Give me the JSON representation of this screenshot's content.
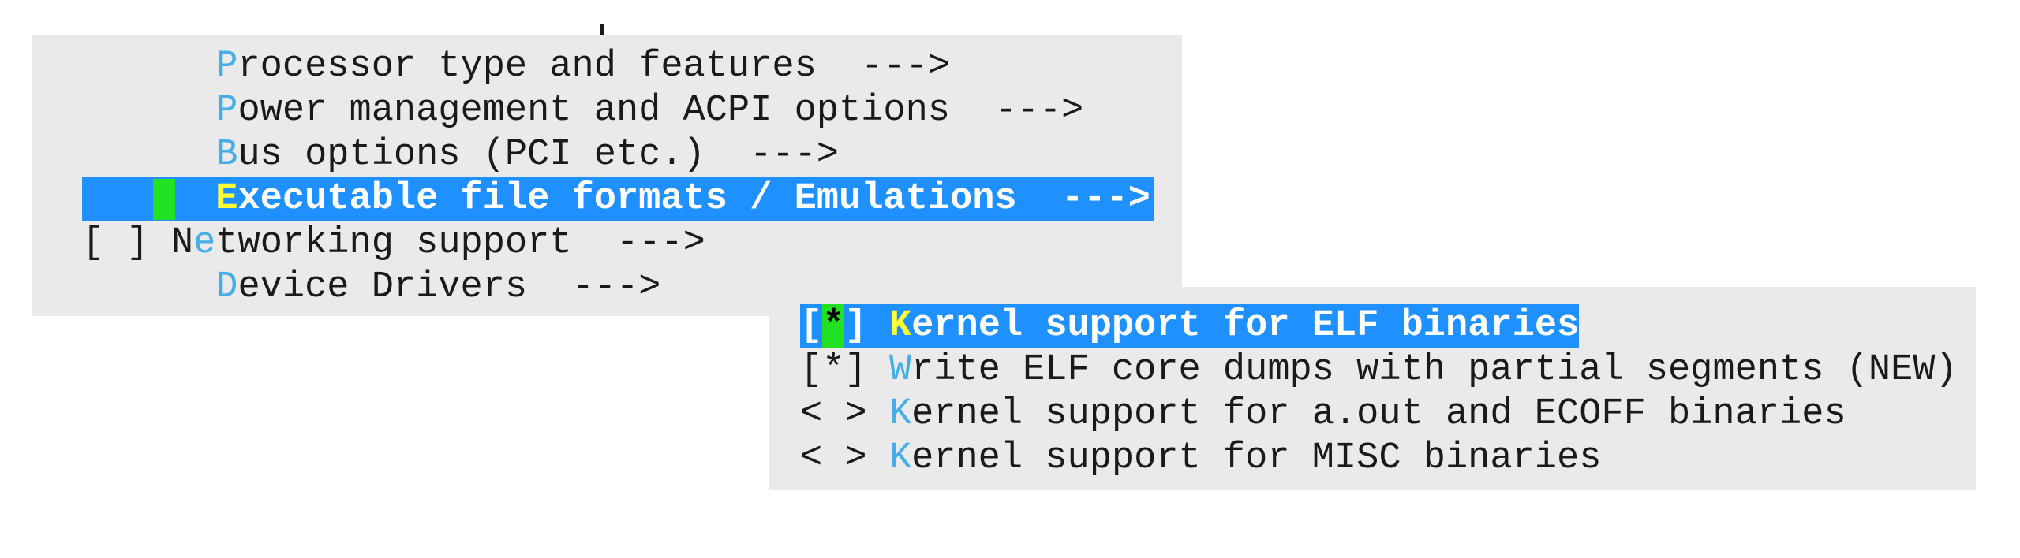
{
  "top_menu": {
    "items": [
      {
        "indicator": "   ",
        "hotkey": "P",
        "rest": "rocessor type and features",
        "arrow": "--->"
      },
      {
        "indicator": "   ",
        "hotkey": "P",
        "rest": "ower management and ACPI options",
        "arrow": "--->"
      },
      {
        "indicator": "   ",
        "hotkey": "B",
        "rest": "us options (PCI etc.)",
        "arrow": "--->"
      },
      {
        "indicator": "   ",
        "hotkey": "E",
        "rest": "xecutable file formats / Emulations",
        "arrow": "--->"
      },
      {
        "indicator": "[ ]",
        "prefix": "N",
        "hotkey": "e",
        "rest": "tworking support",
        "arrow": "--->"
      },
      {
        "indicator": "   ",
        "hotkey": "D",
        "rest": "evice Drivers",
        "arrow": "--->"
      }
    ]
  },
  "sub_menu": {
    "items": [
      {
        "open": "[",
        "mark": "*",
        "close": "]",
        "hotkey": "K",
        "rest": "ernel support for ELF binaries"
      },
      {
        "indicator": "[*]",
        "hotkey": "W",
        "rest": "rite ELF core dumps with partial segments (NEW)"
      },
      {
        "indicator": "< >",
        "hotkey": "K",
        "rest": "ernel support for a.out and ECOFF binaries"
      },
      {
        "indicator": "< >",
        "hotkey": "K",
        "rest": "ernel support for MISC binaries"
      }
    ]
  },
  "colors": {
    "panel_bg": "#eaeaea",
    "highlight_bg": "#1e90ff",
    "hotkey": "#45aee6",
    "highlight_hotkey": "#ffff33",
    "cursor": "#22e022"
  }
}
